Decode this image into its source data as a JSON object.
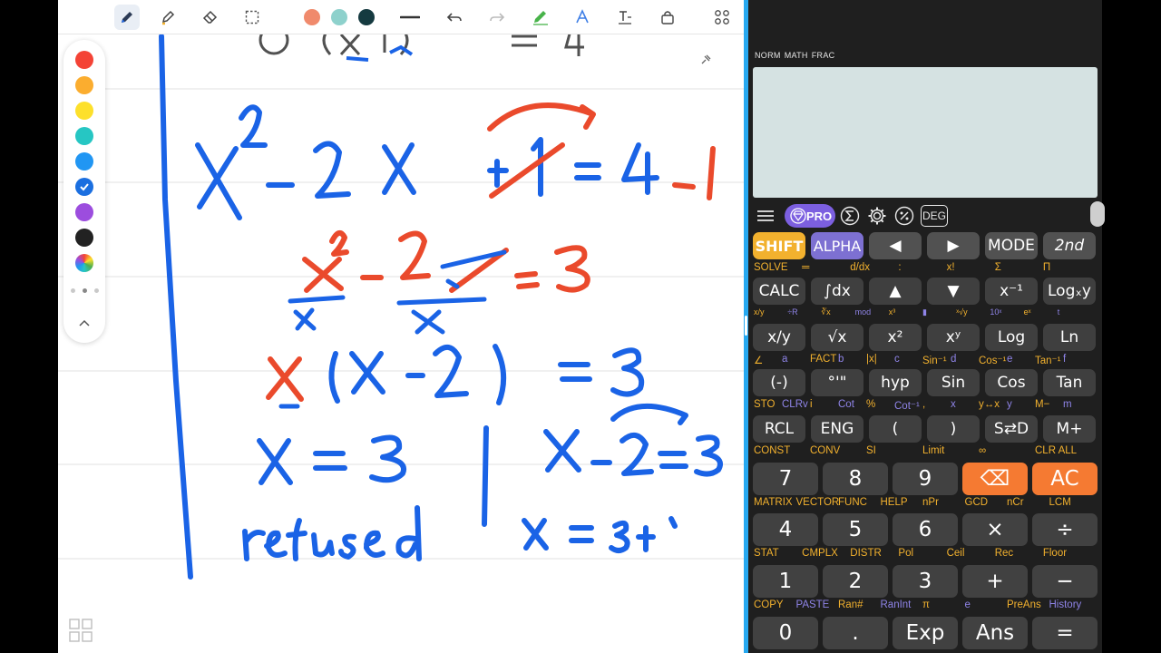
{
  "notes_app": {
    "toolbar": {
      "tools": [
        "pen",
        "highlighter",
        "eraser",
        "lasso",
        "undo",
        "redo",
        "shape",
        "text-recognition",
        "text",
        "lock",
        "more"
      ],
      "pen_colors": [
        "#f08a6c",
        "#8ed1cc",
        "#153a40"
      ]
    },
    "palette": {
      "colors": [
        "#f44336",
        "#fbad2f",
        "#fde02b",
        "#26c6c3",
        "#2196f3",
        "#1b6fe0",
        "#9c4dde",
        "#222222"
      ],
      "selected_index": 5
    },
    "ink_colors": {
      "blue": "#1a63e6",
      "red": "#ea4a2c"
    }
  },
  "calculator": {
    "status": [
      "NORM",
      "MATH",
      "FRAC"
    ],
    "menu": {
      "pro_label": "PRO",
      "angle_label": "DEG"
    },
    "rows": [
      {
        "keys": [
          {
            "id": "shift",
            "label": "SHIFT"
          },
          {
            "id": "alpha",
            "label": "ALPHA"
          },
          {
            "id": "left",
            "label": "◀"
          },
          {
            "id": "right",
            "label": "▶"
          },
          {
            "id": "mode",
            "label": "MODE"
          },
          {
            "id": "second",
            "label": "2nd"
          }
        ],
        "labels": [
          "SOLVE",
          "═",
          "d/dx",
          ":",
          "x!",
          "Σ",
          "Π"
        ]
      },
      {
        "keys": [
          {
            "id": "calc",
            "label": "CALC"
          },
          {
            "id": "integral",
            "label": "∫dx"
          },
          {
            "id": "up",
            "label": "▲"
          },
          {
            "id": "down",
            "label": "▼"
          },
          {
            "id": "reciprocal",
            "label": "x⁻¹"
          },
          {
            "id": "logxy",
            "label": "Logₓy"
          }
        ],
        "labels": [
          "x/y",
          "÷R",
          "∛x",
          "mod",
          "x³",
          "▮",
          "ˣ√y",
          "10ˣ",
          "eˣ",
          "t"
        ]
      },
      {
        "keys": [
          {
            "id": "fraction",
            "label": "x/y"
          },
          {
            "id": "sqrt",
            "label": "√x"
          },
          {
            "id": "square",
            "label": "x²"
          },
          {
            "id": "power",
            "label": "xʸ"
          },
          {
            "id": "log",
            "label": "Log"
          },
          {
            "id": "ln",
            "label": "Ln"
          }
        ],
        "labels": [
          "∠",
          "a",
          "FACT",
          "b",
          "|x|",
          "c",
          "Sin⁻¹",
          "d",
          "Cos⁻¹",
          "e",
          "Tan⁻¹",
          "f"
        ]
      },
      {
        "keys": [
          {
            "id": "negative",
            "label": "(-)"
          },
          {
            "id": "dms",
            "label": "°'\""
          },
          {
            "id": "hyp",
            "label": "hyp"
          },
          {
            "id": "sin",
            "label": "Sin"
          },
          {
            "id": "cos",
            "label": "Cos"
          },
          {
            "id": "tan",
            "label": "Tan"
          }
        ],
        "labels": [
          "STO",
          "CLRv",
          "i",
          "Cot",
          "%",
          "Cot⁻¹",
          ",",
          "x",
          "y↔x",
          "y",
          "M−",
          "m"
        ]
      },
      {
        "keys": [
          {
            "id": "rcl",
            "label": "RCL"
          },
          {
            "id": "eng",
            "label": "ENG"
          },
          {
            "id": "open-paren",
            "label": "("
          },
          {
            "id": "close-paren",
            "label": ")"
          },
          {
            "id": "s-to-d",
            "label": "S⇄D"
          },
          {
            "id": "m-plus",
            "label": "M+"
          }
        ],
        "labels": [
          "CONST",
          "CONV",
          "SI",
          "Limit",
          "∞",
          "CLR ALL"
        ]
      },
      {
        "keys": [
          {
            "id": "seven",
            "label": "7"
          },
          {
            "id": "eight",
            "label": "8"
          },
          {
            "id": "nine",
            "label": "9"
          },
          {
            "id": "del",
            "label": "⌫"
          },
          {
            "id": "ac",
            "label": "AC"
          }
        ],
        "labels": [
          "MATRIX",
          "VECTOR",
          "FUNC",
          "HELP",
          "nPr",
          "GCD",
          "nCr",
          "LCM"
        ]
      },
      {
        "keys": [
          {
            "id": "four",
            "label": "4"
          },
          {
            "id": "five",
            "label": "5"
          },
          {
            "id": "six",
            "label": "6"
          },
          {
            "id": "multiply",
            "label": "×"
          },
          {
            "id": "divide",
            "label": "÷"
          }
        ],
        "labels": [
          "STAT",
          "CMPLX",
          "DISTR",
          "Pol",
          "Ceil",
          "Rec",
          "Floor"
        ]
      },
      {
        "keys": [
          {
            "id": "one",
            "label": "1"
          },
          {
            "id": "two",
            "label": "2"
          },
          {
            "id": "three",
            "label": "3"
          },
          {
            "id": "plus",
            "label": "+"
          },
          {
            "id": "minus",
            "label": "−"
          }
        ],
        "labels": [
          "COPY",
          "PASTE",
          "Ran#",
          "RanInt",
          "π",
          "e",
          "PreAns",
          "History"
        ]
      },
      {
        "keys": [
          {
            "id": "zero",
            "label": "0"
          },
          {
            "id": "dot",
            "label": "."
          },
          {
            "id": "exp",
            "label": "Exp"
          },
          {
            "id": "ans",
            "label": "Ans"
          },
          {
            "id": "equals",
            "label": "="
          }
        ]
      }
    ]
  }
}
